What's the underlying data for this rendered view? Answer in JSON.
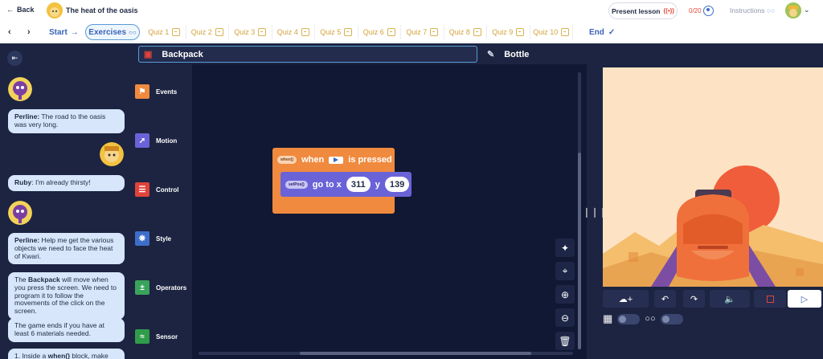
{
  "header": {
    "back_label": "Back",
    "lesson_title": "The heat of the oasis",
    "present_label": "Present lesson",
    "progress": "0/20",
    "instructions_label": "Instructions"
  },
  "nav": {
    "start_label": "Start",
    "exercises_label": "Exercises",
    "quizzes": [
      "Quiz 1",
      "Quiz 2",
      "Quiz 3",
      "Quiz 4",
      "Quiz 5",
      "Quiz 6",
      "Quiz 7",
      "Quiz 8",
      "Quiz 9",
      "Quiz 10"
    ],
    "end_label": "End"
  },
  "chat": {
    "messages": [
      {
        "speaker": "Perline:",
        "text": " The road to the oasis was very long."
      },
      {
        "speaker": "Ruby",
        "text": ": I'm already thirsty!"
      },
      {
        "speaker": "Perline:",
        "text": " Help me get the various objects we need to face the heat of Kwari."
      },
      {
        "speaker": "The",
        "bold": " Backpack",
        "text": " will move when you press the screen. We need to program it to follow the movements of the click on the screen."
      },
      {
        "speaker": "The game ends if you have at least 6 materials needed.",
        "text": ""
      },
      {
        "speaker": "1. Inside a ",
        "bold": "when()",
        "text": " block, make the"
      }
    ]
  },
  "categories": [
    {
      "label": "Events",
      "color": "#f08a3e",
      "icon": "flag-icon"
    },
    {
      "label": "Motion",
      "color": "#6a63d8",
      "icon": "motion-icon"
    },
    {
      "label": "Control",
      "color": "#e0433b",
      "icon": "control-icon"
    },
    {
      "label": "Style",
      "color": "#3d6ec9",
      "icon": "style-icon"
    },
    {
      "label": "Operators",
      "color": "#3aa35b",
      "icon": "operators-icon"
    },
    {
      "label": "Sensor",
      "color": "#2f9c4a",
      "icon": "sensor-icon"
    }
  ],
  "sprites": {
    "active": "Backpack",
    "other": "Bottle"
  },
  "blocks": {
    "when_pill": "when()",
    "when_label": "when",
    "pressed_label": "is pressed",
    "setpos_pill": "setPos()",
    "goto_label": "go to x",
    "x_value": "311",
    "y_label": "y",
    "y_value": "139"
  },
  "colors": {
    "panel": "#1c2442",
    "workspace": "#101833",
    "accent": "#5b9ad6",
    "events": "#f08a3e",
    "motion": "#6a63d8"
  }
}
